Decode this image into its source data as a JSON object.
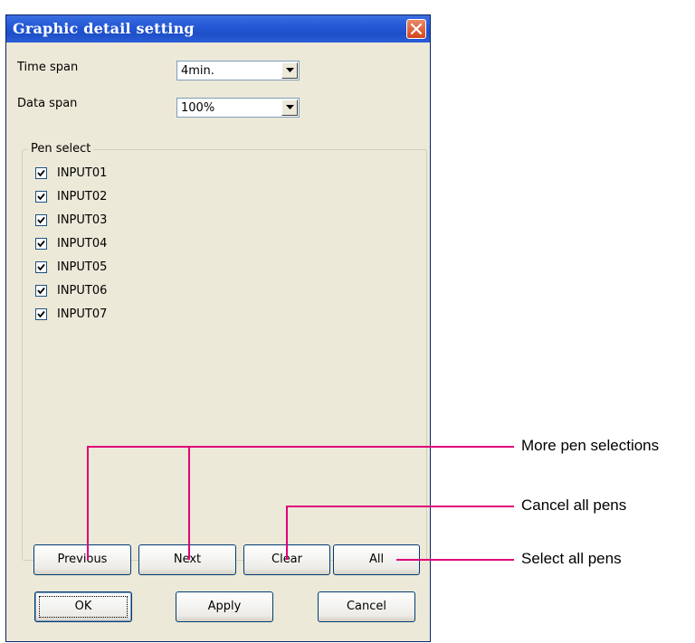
{
  "dialog": {
    "title": "Graphic detail setting",
    "time_span": {
      "label": "Time span",
      "value": "4min."
    },
    "data_span": {
      "label": "Data span",
      "value": "100%"
    },
    "pen_select": {
      "title": "Pen select",
      "items": [
        {
          "label": "INPUT01",
          "checked": true
        },
        {
          "label": "INPUT02",
          "checked": true
        },
        {
          "label": "INPUT03",
          "checked": true
        },
        {
          "label": "INPUT04",
          "checked": true
        },
        {
          "label": "INPUT05",
          "checked": true
        },
        {
          "label": "INPUT06",
          "checked": true
        },
        {
          "label": "INPUT07",
          "checked": true
        }
      ]
    },
    "pen_buttons": {
      "previous": "Previous",
      "next": "Next",
      "clear": "Clear",
      "all": "All"
    },
    "footer_buttons": {
      "ok": "OK",
      "apply": "Apply",
      "cancel": "Cancel"
    }
  },
  "callouts": {
    "more_pens": "More pen selections",
    "cancel_all": "Cancel all pens",
    "select_all": "Select all pens"
  },
  "colors": {
    "title_bar": "#2458d6",
    "dialog_bg": "#ece9d8",
    "callout_line": "#e0007a",
    "close_button": "#d5441c"
  },
  "icons": {
    "close": "close-icon",
    "dropdown": "chevron-down-icon",
    "check": "check-icon"
  }
}
